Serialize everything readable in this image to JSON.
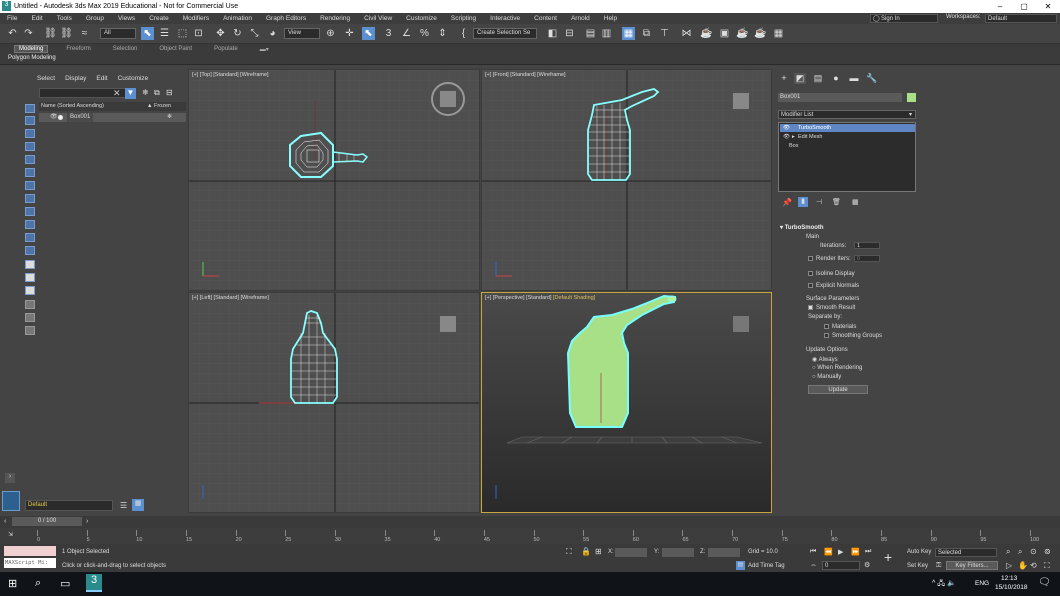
{
  "window": {
    "title": "Untitled - Autodesk 3ds Max 2019 Educational - Not for Commercial Use",
    "controls": [
      "–",
      "▢",
      "✕"
    ]
  },
  "menu": [
    "File",
    "Edit",
    "Tools",
    "Group",
    "Views",
    "Create",
    "Modifiers",
    "Animation",
    "Graph Editors",
    "Rendering",
    "Civil View",
    "Customize",
    "Scripting",
    "Interactive",
    "Content",
    "Arnold",
    "Help"
  ],
  "account": {
    "signin": "Sign In",
    "workspaces_label": "Workspaces:",
    "workspace": "Default"
  },
  "toolbar": {
    "filter": "All",
    "view": "View",
    "selection_set": "Create Selection Se"
  },
  "ribbon": {
    "tabs": [
      "Modeling",
      "Freeform",
      "Selection",
      "Object Paint",
      "Populate"
    ],
    "active_tab": "Modeling",
    "panel": "Polygon Modeling"
  },
  "scene_explorer": {
    "tabs": [
      "Select",
      "Display",
      "Edit",
      "Customize"
    ],
    "col_name": "Name (Sorted Ascending)",
    "col_frozen": "▲ Frozen",
    "objects": [
      {
        "name": "Box001"
      }
    ]
  },
  "viewports": {
    "top": "[+] [Top] [Standard] [Wireframe]",
    "front": "[+] [Front] [Standard] [Wireframe]",
    "left": "[+] [Left] [Standard] [Wireframe]",
    "perspective_prefix": "[+] [Perspective] [Standard] ",
    "perspective_shading": "[Default Shading]"
  },
  "command_panel": {
    "object_name": "Box001",
    "object_color": "#a8e087",
    "modifier_list": "Modifier List",
    "stack": [
      "TurboSmooth",
      "Edit Mesh",
      "Box"
    ],
    "rollout": {
      "title": "TurboSmooth",
      "main": "Main",
      "iterations_label": "Iterations:",
      "iterations": "1",
      "render_iters_label": "Render Iters:",
      "render_iters": "0",
      "isoline": "Isoline Display",
      "explicit": "Explicit Normals",
      "surface": "Surface Parameters",
      "smooth_result": "Smooth Result",
      "separate_by": "Separate by:",
      "materials": "Materials",
      "smoothing_groups": "Smoothing Groups",
      "update_options": "Update Options",
      "always": "Always",
      "when_rendering": "When Rendering",
      "manually": "Manually",
      "update": "Update"
    }
  },
  "layer": {
    "name": "Default"
  },
  "timeline": {
    "frame": "0 / 100",
    "ticks": [
      "0",
      "5",
      "10",
      "15",
      "20",
      "25",
      "30",
      "35",
      "40",
      "45",
      "50",
      "55",
      "60",
      "65",
      "70",
      "75",
      "80",
      "85",
      "90",
      "95",
      "100"
    ]
  },
  "status": {
    "maxscript": "MAXScript Mi:",
    "selected": "1 Object Selected",
    "prompt": "Click or click-and-drag to select objects",
    "x_label": "X:",
    "y_label": "Y:",
    "z_label": "Z:",
    "grid": "Grid = 10.0",
    "add_time_tag": "Add Time Tag",
    "auto_key": "Auto Key",
    "set_key": "Set Key",
    "key_mode": "Selected",
    "key_filters": "Key Filters...",
    "frame_value": "0"
  },
  "taskbar": {
    "lang": "ENG",
    "time": "12:13",
    "date": "15/10/2018"
  }
}
